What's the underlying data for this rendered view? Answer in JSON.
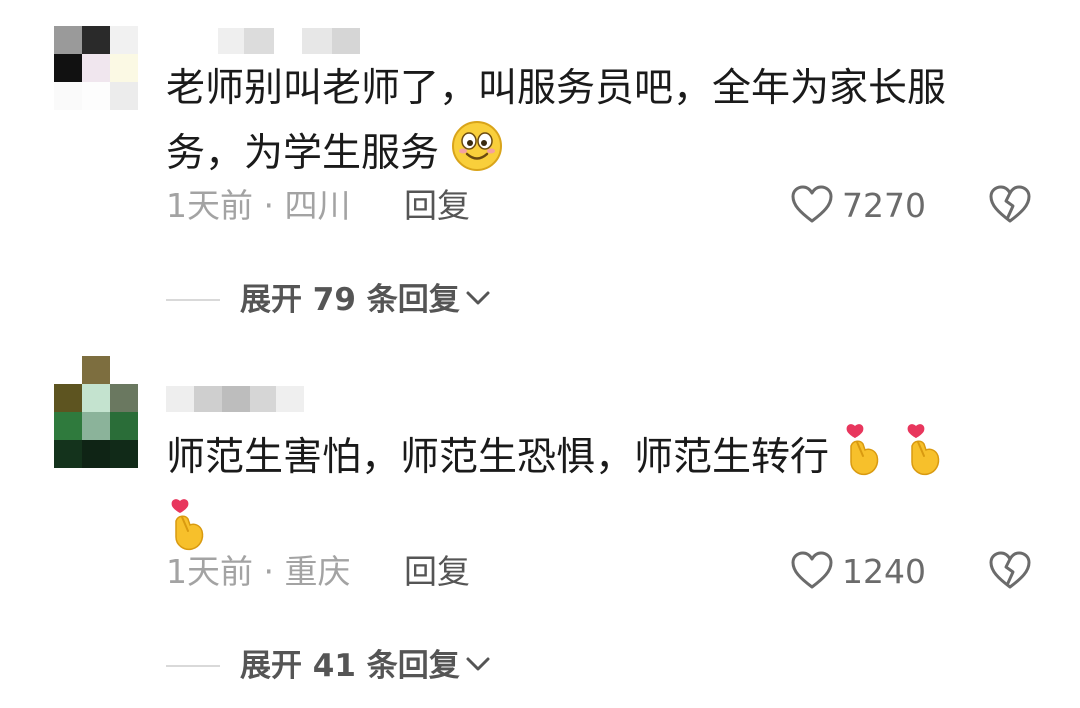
{
  "comments": [
    {
      "text_line1": "老师别叫老师了，叫服务员吧，全年为家长服",
      "text_line2": "务，为学生服务",
      "emoji": "smile-emoji",
      "time": "1天前",
      "separator": "·",
      "location": "四川",
      "reply_label": "回复",
      "likes": "7270",
      "expand_label": "展开 79 条回复"
    },
    {
      "text_line1": "师范生害怕，师范生恐惧，师范生转行",
      "emoji": "finger-heart-emoji",
      "time": "1天前",
      "separator": "·",
      "location": "重庆",
      "reply_label": "回复",
      "likes": "1240",
      "expand_label": "展开 41 条回复"
    }
  ],
  "colors": {
    "meta": "#a3a3a3",
    "action": "#555555",
    "heart_outline": "#6b6b6b",
    "emoji_heart": "#e8365d",
    "emoji_hand": "#f7c02b"
  }
}
